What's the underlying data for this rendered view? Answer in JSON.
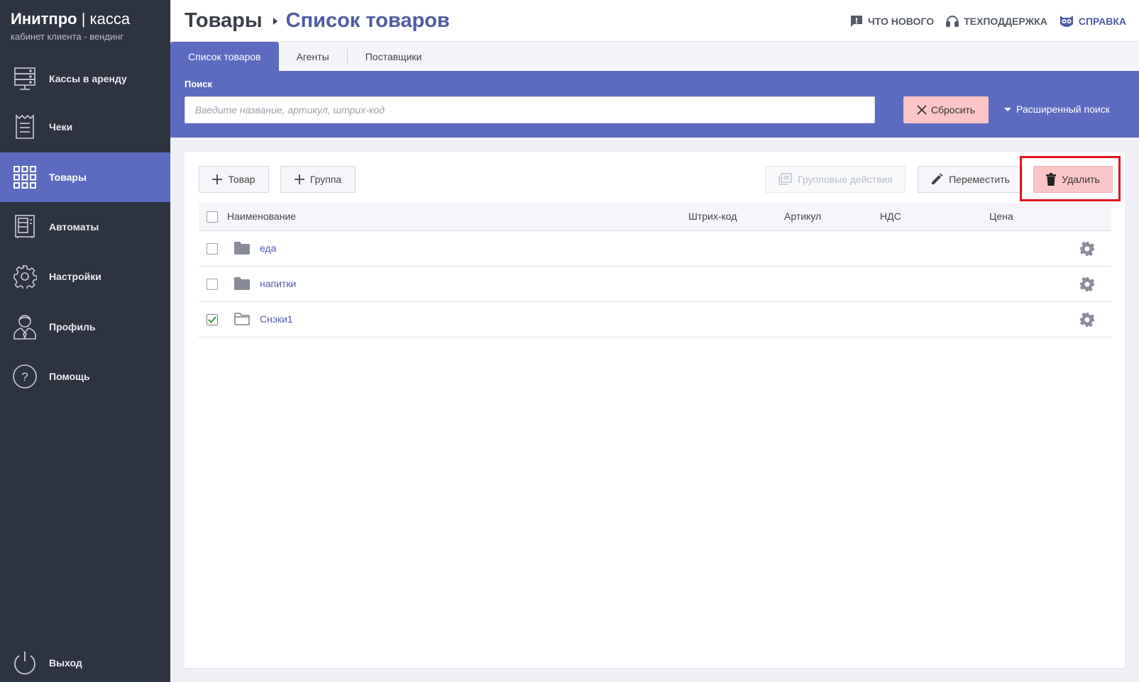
{
  "brand": {
    "name_bold": "Инитпро",
    "name_sep": " | ",
    "name_light": "касса",
    "subtitle": "кабинет клиента - вендинг"
  },
  "sidebar": {
    "items": [
      {
        "label": "Кассы в аренду",
        "icon": "server-icon",
        "active": false
      },
      {
        "label": "Чеки",
        "icon": "receipt-icon",
        "active": false
      },
      {
        "label": "Товары",
        "icon": "grid-icon",
        "active": true
      },
      {
        "label": "Автоматы",
        "icon": "vending-machine-icon",
        "active": false
      },
      {
        "label": "Настройки",
        "icon": "gear-icon",
        "active": false
      },
      {
        "label": "Профиль",
        "icon": "user-icon",
        "active": false
      },
      {
        "label": "Помощь",
        "icon": "help-icon",
        "active": false
      }
    ],
    "logout": {
      "label": "Выход",
      "icon": "power-icon"
    }
  },
  "header": {
    "breadcrumb_parent": "Товары",
    "breadcrumb_current": "Список товаров",
    "links": {
      "whats_new": "ЧТО НОВОГО",
      "support": "ТЕХПОДДЕРЖКА",
      "help": "СПРАВКА"
    }
  },
  "tabs": [
    {
      "label": "Список товаров",
      "active": true
    },
    {
      "label": "Агенты",
      "active": false
    },
    {
      "label": "Поставщики",
      "active": false
    }
  ],
  "search": {
    "label": "Поиск",
    "placeholder": "Введите название, артикул, штрих-код",
    "value": "",
    "reset_label": "Сбросить",
    "advanced_label": "Расширенный поиск"
  },
  "toolbar": {
    "add_product": "Товар",
    "add_group": "Группа",
    "group_actions": "Групповые действия",
    "move": "Переместить",
    "delete": "Удалить"
  },
  "table": {
    "columns": {
      "name": "Наименование",
      "barcode": "Штрих-код",
      "article": "Артикул",
      "vat": "НДС",
      "price": "Цена"
    },
    "rows": [
      {
        "name": "еда",
        "type": "folder",
        "checked": false
      },
      {
        "name": "напитки",
        "type": "folder",
        "checked": false
      },
      {
        "name": "Снэки1",
        "type": "folder-open",
        "checked": true
      }
    ]
  },
  "colors": {
    "sidebar_bg": "#2e3340",
    "accent": "#5c6bc0",
    "danger_bg": "#f9c5c6",
    "highlight": "#e0141e",
    "link": "#4f5ba6"
  }
}
